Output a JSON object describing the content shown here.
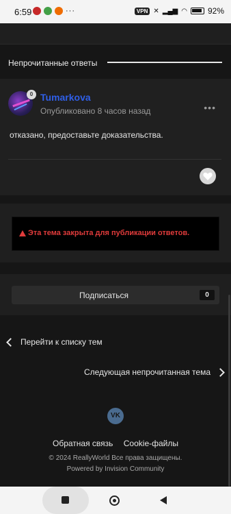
{
  "status_bar": {
    "time": "6:59",
    "vpn": "VPN",
    "battery": "92%"
  },
  "section": {
    "title": "Непрочитанные ответы"
  },
  "post": {
    "author": "Tumarkova",
    "rank_badge": "0",
    "published": "Опубликовано 8 часов назад",
    "more": "•••",
    "text": "отказано, предоставьте доказательства."
  },
  "closed_notice": "Эта тема закрыта для публикации ответов.",
  "subscribe": {
    "label": "Подписаться",
    "count": "0"
  },
  "nav": {
    "back_label": "Перейти к списку тем",
    "next_label": "Следующая непрочитанная тема"
  },
  "footer": {
    "vk": "VK",
    "feedback": "Обратная связь",
    "cookies": "Cookie-файлы",
    "copyright": "© 2024 ReallyWorld Все права защищены.",
    "powered": "Powered by Invision Community"
  },
  "colors": {
    "author": "#2f5fe8",
    "warning": "#e03b3b",
    "background": "#161616"
  }
}
